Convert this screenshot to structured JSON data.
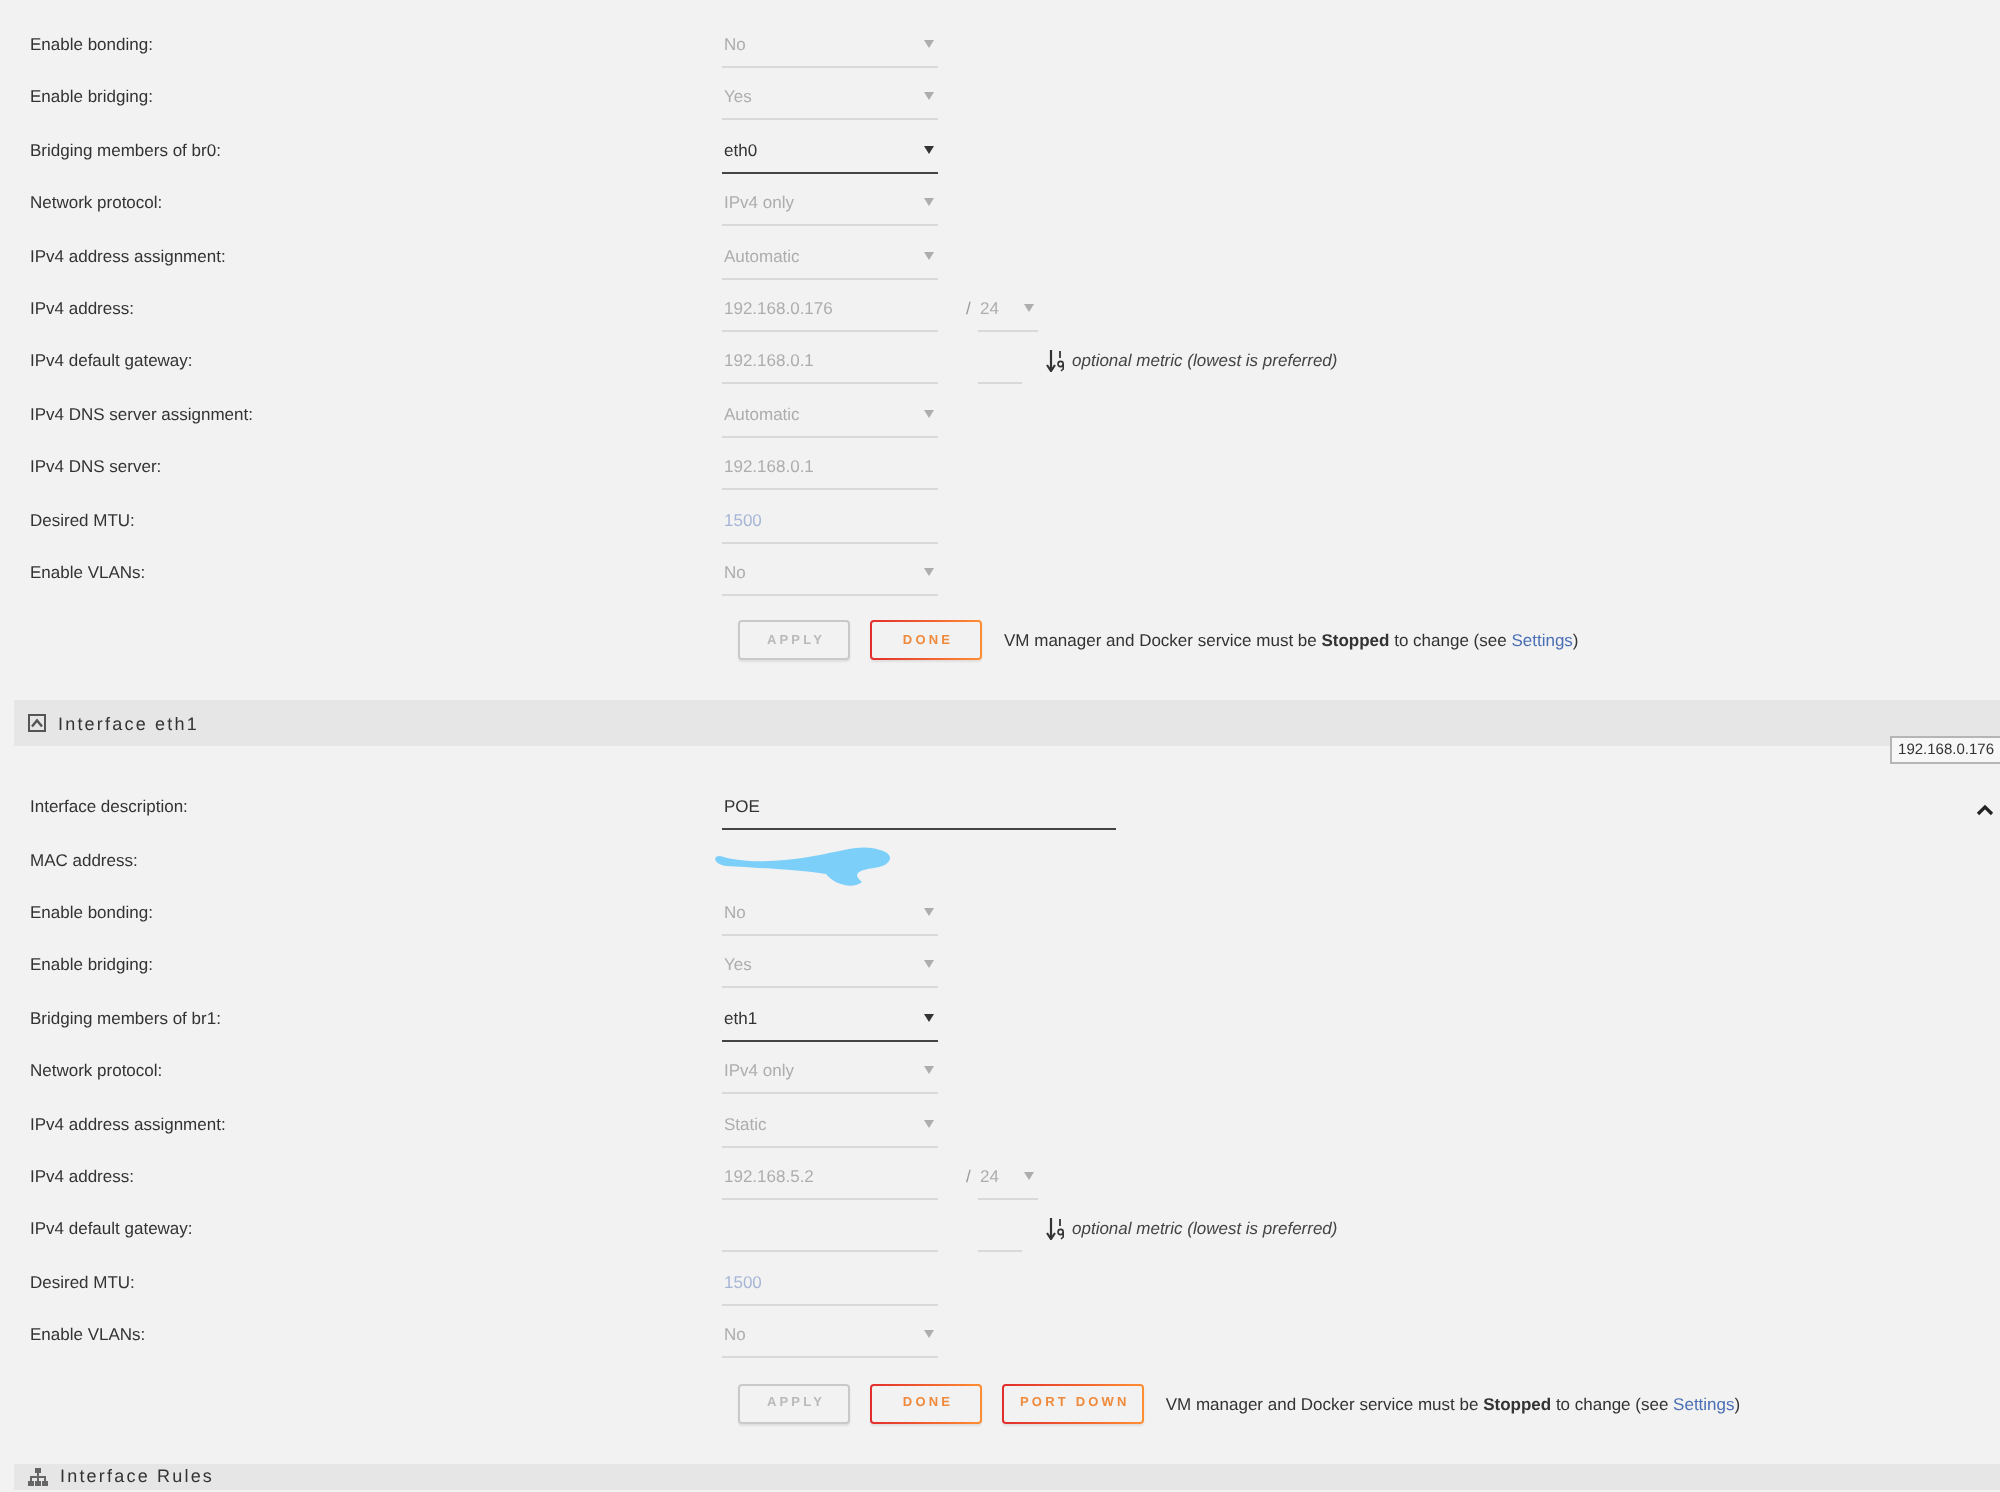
{
  "interfaces": [
    {
      "rows": [
        {
          "label": "Enable bonding:",
          "kind": "select",
          "value": "No",
          "disabled": true
        },
        {
          "label": "Enable bridging:",
          "kind": "select",
          "value": "Yes",
          "disabled": true
        },
        {
          "label": "Bridging members of br0:",
          "kind": "select",
          "value": "eth0",
          "disabled": false
        },
        {
          "label": "Network protocol:",
          "kind": "select",
          "value": "IPv4 only",
          "disabled": true
        },
        {
          "label": "IPv4 address assignment:",
          "kind": "select",
          "value": "Automatic",
          "disabled": true
        },
        {
          "label": "IPv4 address:",
          "kind": "address",
          "value": "192.168.0.176",
          "separator": "/",
          "prefix": "24",
          "disabled": true
        },
        {
          "label": "IPv4 default gateway:",
          "kind": "gateway",
          "value": "192.168.0.1",
          "hint": "optional metric (lowest is preferred)",
          "disabled": true
        },
        {
          "label": "IPv4 DNS server assignment:",
          "kind": "select",
          "value": "Automatic",
          "disabled": true
        },
        {
          "label": "IPv4 DNS server:",
          "kind": "text",
          "value": "192.168.0.1",
          "disabled": true
        },
        {
          "label": "Desired MTU:",
          "kind": "text",
          "placeholder": "1500",
          "disabled": true
        },
        {
          "label": "Enable VLANs:",
          "kind": "select",
          "value": "No",
          "disabled": true
        }
      ],
      "buttons": [
        {
          "label": "APPLY",
          "disabled": true
        },
        {
          "label": "DONE",
          "disabled": false
        }
      ],
      "note": {
        "text": "VM manager and Docker service must be **Stopped** to change (see ",
        "link": "Settings",
        "after": ")"
      }
    },
    {
      "header": {
        "title": "Interface eth1",
        "expanded": true
      },
      "tooltip": "192.168.0.176",
      "rows": [
        {
          "label": "Interface description:",
          "kind": "wide_text",
          "value": "POE",
          "disabled": false
        },
        {
          "label": "MAC address:",
          "kind": "redacted"
        },
        {
          "label": "Enable bonding:",
          "kind": "select",
          "value": "No",
          "disabled": true
        },
        {
          "label": "Enable bridging:",
          "kind": "select",
          "value": "Yes",
          "disabled": true
        },
        {
          "label": "Bridging members of br1:",
          "kind": "select",
          "value": "eth1",
          "disabled": false
        },
        {
          "label": "Network protocol:",
          "kind": "select",
          "value": "IPv4 only",
          "disabled": true
        },
        {
          "label": "IPv4 address assignment:",
          "kind": "select",
          "value": "Static",
          "disabled": true
        },
        {
          "label": "IPv4 address:",
          "kind": "address",
          "value": "192.168.5.2",
          "separator": "/",
          "prefix": "24",
          "disabled": true
        },
        {
          "label": "IPv4 default gateway:",
          "kind": "gateway",
          "hint": "optional metric (lowest is preferred)",
          "disabled": true
        },
        {
          "label": "Desired MTU:",
          "kind": "text",
          "placeholder": "1500",
          "disabled": true
        },
        {
          "label": "Enable VLANs:",
          "kind": "select",
          "value": "No",
          "disabled": true
        }
      ],
      "buttons": [
        {
          "label": "APPLY",
          "disabled": true
        },
        {
          "label": "DONE",
          "disabled": false
        },
        {
          "label": "PORT DOWN",
          "disabled": false
        }
      ],
      "note": {
        "text": "VM manager and Docker service must be **Stopped** to change (see ",
        "link": "Settings",
        "after": ")"
      }
    }
  ],
  "rules_header": {
    "title": "Interface Rules"
  }
}
